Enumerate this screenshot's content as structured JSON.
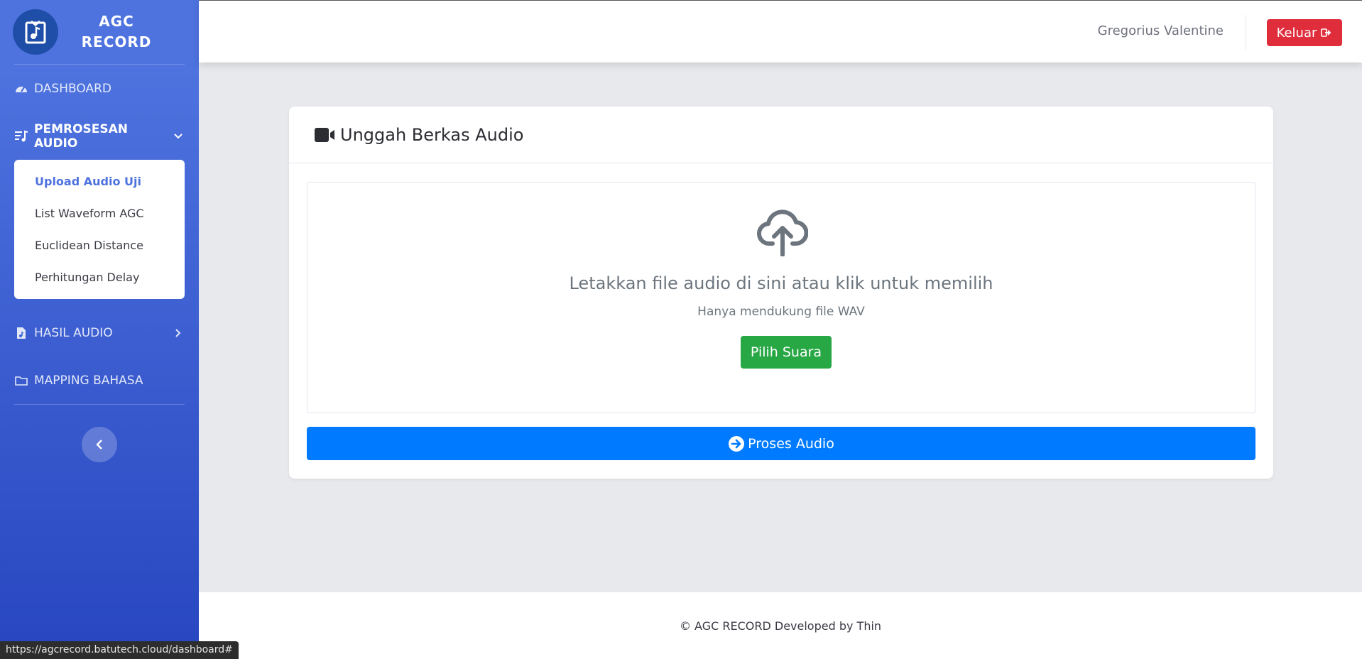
{
  "brand": {
    "line1": "AGC",
    "line2": "RECORD",
    "logo_icon": "music-file-icon"
  },
  "sidebar": {
    "dashboard": {
      "label": "DASHBOARD",
      "icon": "tachometer-icon"
    },
    "pemrosesan": {
      "label": "PEMROSESAN AUDIO",
      "icon": "music-list-icon",
      "expanded": true
    },
    "submenu": [
      {
        "label": "Upload Audio Uji",
        "active": true
      },
      {
        "label": "List Waveform AGC"
      },
      {
        "label": "Euclidean Distance"
      },
      {
        "label": "Perhitungan Delay"
      }
    ],
    "hasil": {
      "label": "HASIL AUDIO",
      "icon": "audio-file-icon"
    },
    "mapping": {
      "label": "MAPPING BAHASA",
      "icon": "folder-icon"
    }
  },
  "topbar": {
    "user_name": "Gregorius Valentine",
    "logout_label": "Keluar"
  },
  "card": {
    "title": "Unggah Berkas Audio",
    "drop_title": "Letakkan file audio di sini atau klik untuk memilih",
    "drop_sub": "Hanya mendukung file WAV",
    "choose_label": "Pilih Suara",
    "process_label": "Proses Audio"
  },
  "footer": {
    "text": "© AGC RECORD Developed by Thin"
  },
  "statusbar": {
    "url": "https://agcrecord.batutech.cloud/dashboard#"
  },
  "colors": {
    "sidebar_top": "#4e73df",
    "sidebar_bottom": "#2746c0",
    "logout": "#e02d3c",
    "choose": "#28a745",
    "process": "#007bff"
  }
}
